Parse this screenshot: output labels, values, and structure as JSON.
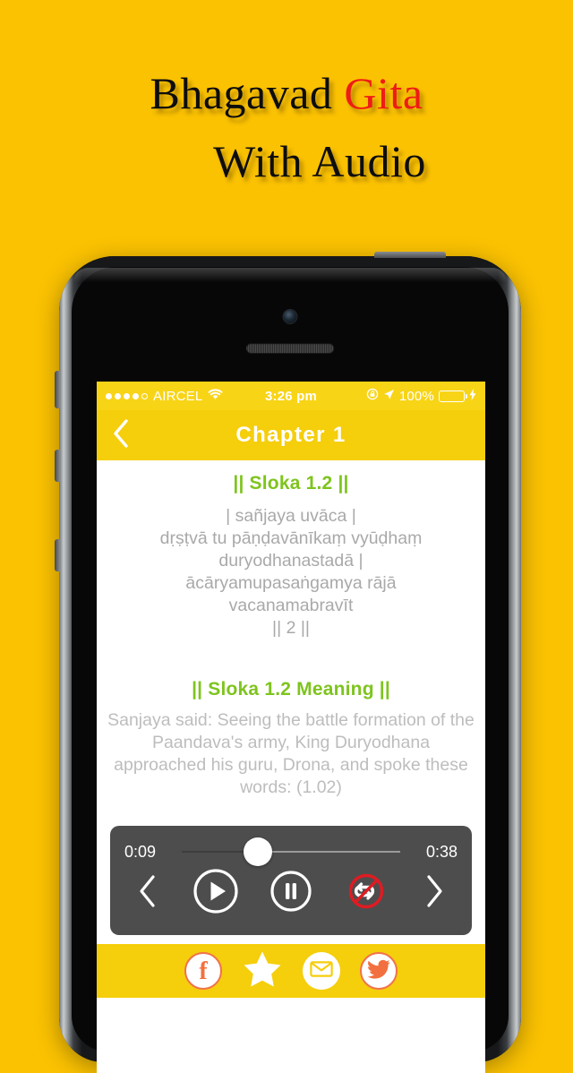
{
  "promo": {
    "line1_a": "Bhagavad ",
    "line1_b": "Gita",
    "line2": "With Audio",
    "accent_color": "#EE1C15",
    "background_color": "#FBC202"
  },
  "status_bar": {
    "signal_dots_filled": 4,
    "signal_dots_total": 5,
    "carrier": "AIRCEL",
    "wifi_icon": "wifi-icon",
    "time": "3:26 pm",
    "rotation_lock_icon": "rotation-lock-icon",
    "location_icon": "location-arrow-icon",
    "battery_percent": "100%",
    "battery_color": "#35D82F",
    "charging_icon": "lightning-bolt-icon"
  },
  "nav_bar": {
    "back_icon": "chevron-left-icon",
    "title": "Chapter 1",
    "background_color": "#F5CE0C"
  },
  "content": {
    "sloka_heading": "|| Sloka 1.2 ||",
    "sloka_text": "| sañjaya uvāca |\ndṛṣṭvā tu pāṇḍavānīkaṃ vyūḍhaṃ\nduryodhanastadā |\nācāryamupasaṅgamya rājā\nvacanamabravīt\n|| 2 ||",
    "meaning_heading": "|| Sloka 1.2 Meaning ||",
    "meaning_text": "Sanjaya said: Seeing the battle formation of the Paandava's army, King Duryodhana approached his guru, Drona, and spoke these words: (1.02)",
    "heading_color": "#7EC41D"
  },
  "player": {
    "time_elapsed": "0:09",
    "time_total": "0:38",
    "progress_percent": 35,
    "background_color": "#4D4D4D",
    "controls": {
      "previous_icon": "chevron-left-icon",
      "play_icon": "play-circle-icon",
      "pause_icon": "pause-circle-icon",
      "repeat_off_icon": "repeat-off-icon",
      "next_icon": "chevron-right-icon"
    },
    "repeat_disabled_color": "#E01B22"
  },
  "share_bar": {
    "items": [
      {
        "name": "facebook",
        "icon": "facebook-icon",
        "label": "f"
      },
      {
        "name": "favorite",
        "icon": "star-icon",
        "label": ""
      },
      {
        "name": "email",
        "icon": "envelope-icon",
        "label": ""
      },
      {
        "name": "twitter",
        "icon": "twitter-icon",
        "label": ""
      }
    ],
    "background_color": "#F5CE0C"
  }
}
